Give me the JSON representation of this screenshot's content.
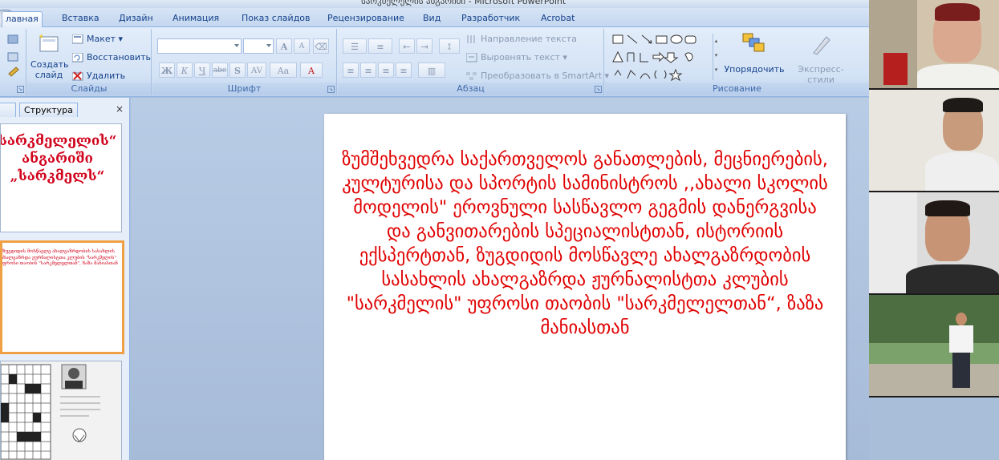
{
  "window": {
    "title": "სარკმელელის ანგარიში - Microsoft PowerPoint"
  },
  "ribbon": {
    "tabs": [
      {
        "label": "лавная",
        "active": true
      },
      {
        "label": "Вставка"
      },
      {
        "label": "Дизайн"
      },
      {
        "label": "Анимация"
      },
      {
        "label": "Показ слайдов"
      },
      {
        "label": "Рецензирование"
      },
      {
        "label": "Вид"
      },
      {
        "label": "Разработчик"
      },
      {
        "label": "Acrobat"
      }
    ],
    "slides_group": {
      "label": "Слайды",
      "create_slide": "Создать слайд",
      "layout": "Макет",
      "reset": "Восстановить",
      "delete": "Удалить"
    },
    "font_group": {
      "label": "Шрифт",
      "bold": "Ж",
      "italic": "К",
      "underline": "Ч",
      "strike": "abe",
      "shadow": "S",
      "spacing": "AV",
      "case": "Aa",
      "grow": "A",
      "shrink": "A"
    },
    "paragraph_group": {
      "label": "Абзац",
      "text_direction": "Направление текста",
      "align_text": "Выровнять текст",
      "smartart": "Преобразовать в SmartArt"
    },
    "drawing_group": {
      "label": "Рисование",
      "arrange": "Упорядочить",
      "quick_styles": "Экспресс-стили"
    }
  },
  "left_panel": {
    "tab_structure": "Структура",
    "close": "×",
    "thumb1_text": "სარკმელელის“ ანგარიში „სარკმელს“",
    "thumb2_text": "ზუგდიდის მოსწავლე ახალგაზრდობის სასახლის ახალგაზრდა ჟურნალისტთა კლუბის \"სარკმელის\" უფროსი თაობის \"სარკმელელთან\", ზაზა მანიასთან"
  },
  "slide": {
    "text": "ზუმშეხვედრა საქართველოს განათლების, მეცნიერების, კულტურისა და სპორტის სამინისტროს ,,ახალი სკოლის მოდელის\" ეროვნული სასწავლო გეგმის დანერგვისა და განვითარების სპეციალისტთან, ისტორიის ექსპერტთან, ზუგდიდის მოსწავლე ახალგაზრდობის სასახლის ახალგაზრდა ჟურნალისტთა კლუბის \"სარკმელის\" უფროსი თაობის \"სარკმელელთან“, ზაზა მანიასთან"
  },
  "colors": {
    "ribbon_accent": "#15428b",
    "slide_text": "#e00000",
    "selected_thumb": "#f0a044"
  }
}
